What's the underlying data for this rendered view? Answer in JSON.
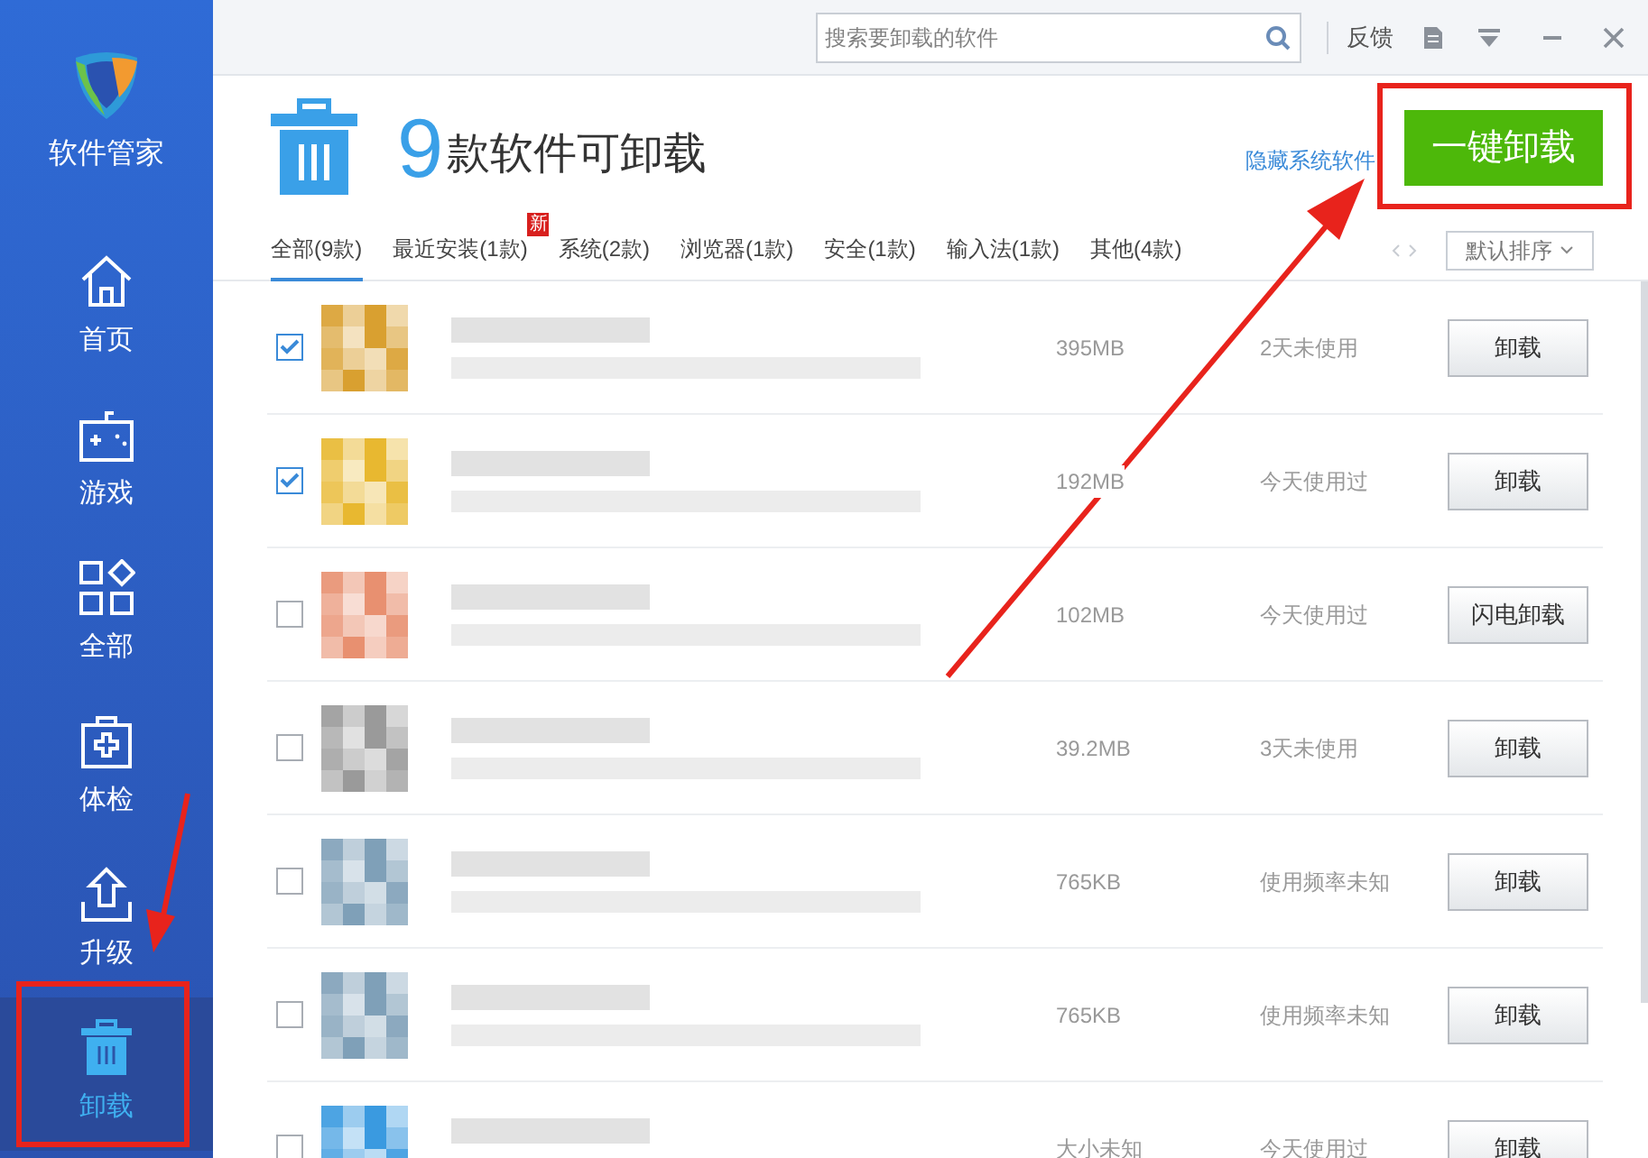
{
  "app": {
    "name": "软件管家"
  },
  "sidebar": {
    "items": [
      {
        "label": "首页",
        "kind": "home",
        "selected": false
      },
      {
        "label": "游戏",
        "kind": "game",
        "selected": false
      },
      {
        "label": "全部",
        "kind": "all",
        "selected": false
      },
      {
        "label": "体检",
        "kind": "checkup",
        "selected": false
      },
      {
        "label": "升级",
        "kind": "upgrade",
        "selected": false
      },
      {
        "label": "卸载",
        "kind": "uninstall",
        "selected": true
      }
    ]
  },
  "search": {
    "placeholder": "搜索要卸载的软件"
  },
  "titlebar": {
    "feedback": "反馈"
  },
  "header": {
    "count": "9",
    "title": "款软件可卸载",
    "hide_system_link": "隐藏系统软件",
    "uninstall_all_button": "一键卸载"
  },
  "tabs": [
    {
      "label": "全部(9款)",
      "selected": true
    },
    {
      "label": "最近安装(1款)",
      "selected": false,
      "badge": "新"
    },
    {
      "label": "系统(2款)",
      "selected": false
    },
    {
      "label": "浏览器(1款)",
      "selected": false
    },
    {
      "label": "安全(1款)",
      "selected": false
    },
    {
      "label": "输入法(1款)",
      "selected": false
    },
    {
      "label": "其他(4款)",
      "selected": false
    }
  ],
  "sort": {
    "label": "默认排序"
  },
  "rows": [
    {
      "checked": true,
      "size": "395MB",
      "usage": "2天未使用",
      "action": "卸载"
    },
    {
      "checked": true,
      "size": "192MB",
      "usage": "今天使用过",
      "action": "卸载"
    },
    {
      "checked": false,
      "size": "102MB",
      "usage": "今天使用过",
      "action": "闪电卸载"
    },
    {
      "checked": false,
      "size": "39.2MB",
      "usage": "3天未使用",
      "action": "卸载"
    },
    {
      "checked": false,
      "size": "765KB",
      "usage": "使用频率未知",
      "action": "卸载"
    },
    {
      "checked": false,
      "size": "765KB",
      "usage": "使用频率未知",
      "action": "卸载"
    },
    {
      "checked": false,
      "size": "大小未知",
      "usage": "今天使用过",
      "action": "卸载"
    }
  ]
}
